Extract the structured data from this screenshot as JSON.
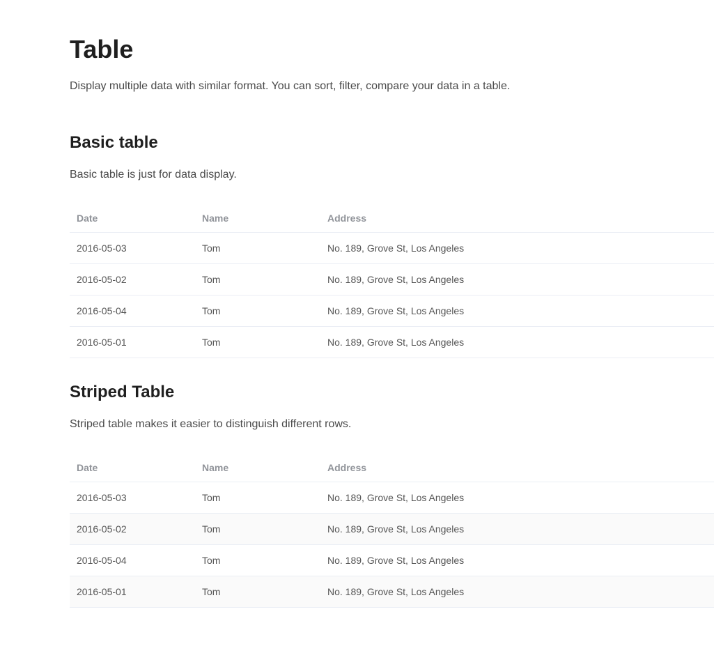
{
  "page": {
    "title": "Table",
    "description": "Display multiple data with similar format. You can sort, filter, compare your data in a table."
  },
  "basic": {
    "title": "Basic table",
    "description": "Basic table is just for data display.",
    "columns": {
      "date": "Date",
      "name": "Name",
      "address": "Address"
    },
    "rows": [
      {
        "date": "2016-05-03",
        "name": "Tom",
        "address": "No. 189, Grove St, Los Angeles"
      },
      {
        "date": "2016-05-02",
        "name": "Tom",
        "address": "No. 189, Grove St, Los Angeles"
      },
      {
        "date": "2016-05-04",
        "name": "Tom",
        "address": "No. 189, Grove St, Los Angeles"
      },
      {
        "date": "2016-05-01",
        "name": "Tom",
        "address": "No. 189, Grove St, Los Angeles"
      }
    ]
  },
  "striped": {
    "title": "Striped Table",
    "description": "Striped table makes it easier to distinguish different rows.",
    "columns": {
      "date": "Date",
      "name": "Name",
      "address": "Address"
    },
    "rows": [
      {
        "date": "2016-05-03",
        "name": "Tom",
        "address": "No. 189, Grove St, Los Angeles"
      },
      {
        "date": "2016-05-02",
        "name": "Tom",
        "address": "No. 189, Grove St, Los Angeles"
      },
      {
        "date": "2016-05-04",
        "name": "Tom",
        "address": "No. 189, Grove St, Los Angeles"
      },
      {
        "date": "2016-05-01",
        "name": "Tom",
        "address": "No. 189, Grove St, Los Angeles"
      }
    ]
  }
}
